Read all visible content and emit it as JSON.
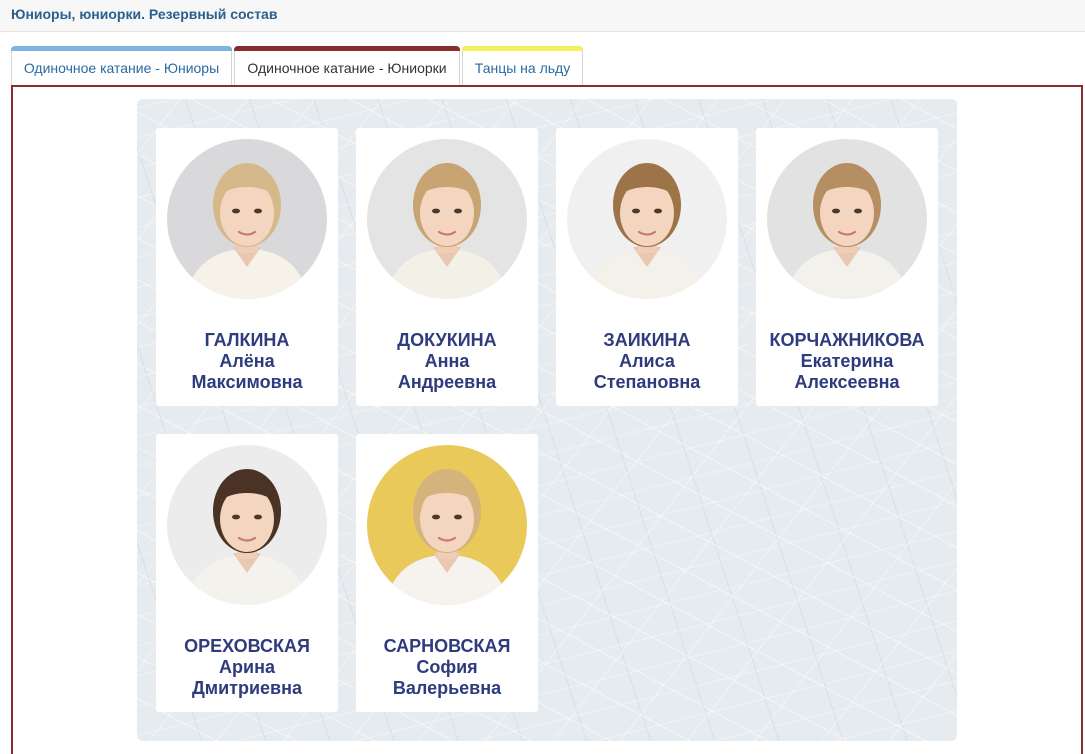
{
  "header": {
    "title": "Юниоры, юниорки. Резервный состав"
  },
  "tabs": [
    {
      "label": "Одиночное катание - Юниоры",
      "accent": "#7cb3e0",
      "active": false
    },
    {
      "label": "Одиночное катание - Юниорки",
      "accent": "#8b2b2b",
      "active": true
    },
    {
      "label": "Танцы на льду",
      "accent": "#f4ef5a",
      "active": false
    }
  ],
  "athletes": [
    {
      "surname": "ГАЛКИНА",
      "first_name": "Алёна",
      "patronymic": "Максимовна",
      "bg": "#d9d9dc",
      "hair": "#d6b98a",
      "shirt": "#f6f2ea"
    },
    {
      "surname": "ДОКУКИНА",
      "first_name": "Анна",
      "patronymic": "Андреевна",
      "bg": "#e4e4e4",
      "hair": "#c8a472",
      "shirt": "#f3f0e8"
    },
    {
      "surname": "ЗАИКИНА",
      "first_name": "Алиса",
      "patronymic": "Степановна",
      "bg": "#f0f0f0",
      "hair": "#9c7448",
      "shirt": "#f4f1ea"
    },
    {
      "surname": "КОРЧАЖНИКОВА",
      "first_name": "Екатерина",
      "patronymic": "Алексеевна",
      "bg": "#e2e2e2",
      "hair": "#b58e62",
      "shirt": "#f3f1eb"
    },
    {
      "surname": "ОРЕХОВСКАЯ",
      "first_name": "Арина",
      "patronymic": "Дмитриевна",
      "bg": "#ececec",
      "hair": "#4a3324",
      "shirt": "#f4f2ec"
    },
    {
      "surname": "САРНОВСКАЯ",
      "first_name": "София",
      "patronymic": "Валерьевна",
      "bg": "#e8c95a",
      "hair": "#d4b37c",
      "shirt": "#f6f3ee"
    }
  ]
}
